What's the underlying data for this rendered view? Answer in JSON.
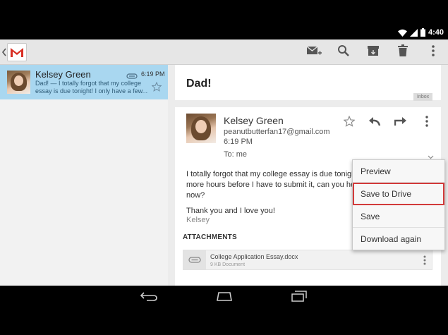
{
  "status_bar": {
    "time": "4:40",
    "icons": [
      "wifi-icon",
      "signal-icon",
      "battery-icon"
    ]
  },
  "action_bar": {
    "app": "Gmail",
    "actions": [
      "compose-icon",
      "search-icon",
      "archive-icon",
      "delete-icon",
      "overflow-menu-icon"
    ]
  },
  "conversation_list": [
    {
      "sender": "Kelsey Green",
      "time": "6:19 PM",
      "snippet": "Dad! — I totally forgot that my college essay is due tonight! I only have a few...",
      "has_attachment": true,
      "starred": false,
      "selected": true
    }
  ],
  "message": {
    "subject": "Dad!",
    "label": "Inbox",
    "sender": "Kelsey Green",
    "email": "peanutbutterfan17@gmail.com",
    "time": "6:19 PM",
    "to": "To: me",
    "body_lines": [
      "I totally forgot that my college essay is due tonigh",
      "more hours before I have to submit it, can you he",
      "now?"
    ],
    "thanks": "Thank you and I love you!",
    "signature": "Kelsey"
  },
  "attachments": {
    "title": "ATTACHMENTS",
    "items": [
      {
        "name": "College Application Essay.docx",
        "size": "9 KB Document"
      }
    ]
  },
  "menu": {
    "items": [
      "Preview",
      "Save to Drive",
      "Save",
      "Download again"
    ],
    "highlighted": "Save to Drive"
  },
  "colors": {
    "selected_row": "#a9d7f0",
    "highlight_border": "#d23a3a",
    "gmail_red": "#d93025"
  }
}
